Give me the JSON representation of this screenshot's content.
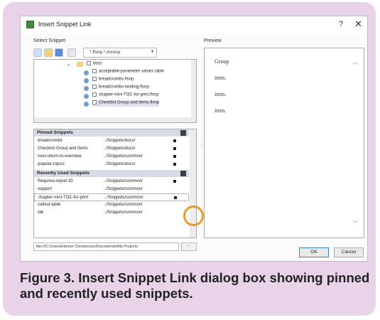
{
  "dialog": {
    "title": "Insert Snippet Link",
    "help_glyph": "?",
    "close_glyph": "✕"
  },
  "select_snippet": {
    "label": "Select Snippet",
    "filter_value": "*.flsnp;*.mcsnp",
    "tree": [
      {
        "label": "docs",
        "checked": false
      },
      {
        "label": "acceptable-parameter values table",
        "checked": false
      },
      {
        "label": "breadcrumbs.flsnp",
        "checked": false
      },
      {
        "label": "breadcrumbs-landing.flsnp",
        "checked": false
      },
      {
        "label": "chapter-mini-TOC-for-print.flsnp",
        "checked": false
      },
      {
        "label": "Checklist Group and Items.flsnp",
        "checked": false
      }
    ]
  },
  "pinned": {
    "header": "Pinned Snippets",
    "rows": [
      {
        "name": "breadcrumbs",
        "path": "../Snippets/docs/"
      },
      {
        "name": "Checklist Group and Items",
        "path": "../Snippets/docs/"
      },
      {
        "name": "next-return-to-overview",
        "path": "../Snippets/common/"
      },
      {
        "name": "popular-topics",
        "path": "../Snippets/docs/"
      }
    ]
  },
  "recent": {
    "header": "Recently Used Snippets",
    "rows": [
      {
        "name": "Requires-report-ID",
        "path": "../Snippets/common/"
      },
      {
        "name": "support",
        "path": "../Snippets/common/"
      },
      {
        "name": "chapter-mini-TOC-for-print",
        "path": "../Snippets/common/"
      },
      {
        "name": "callout-table",
        "path": "../Snippets/common/"
      },
      {
        "name": "tab",
        "path": "../Snippets/common/"
      }
    ]
  },
  "path_field": "file:///C:/Users/Homer Christensen/Documents/My Projects",
  "browse_label": "...",
  "preview": {
    "label": "Preview",
    "lines": [
      "Group",
      "item.",
      "item.",
      "item."
    ]
  },
  "buttons": {
    "ok": "OK",
    "cancel": "Cancel"
  },
  "caption": "Figure 3. Insert Snippet Link dialog box showing pinned and recently used snippets.",
  "colors": {
    "frame": "#e8d3e8",
    "highlight_circle": "#e69b2e",
    "section_header": "#d7dbe3"
  }
}
